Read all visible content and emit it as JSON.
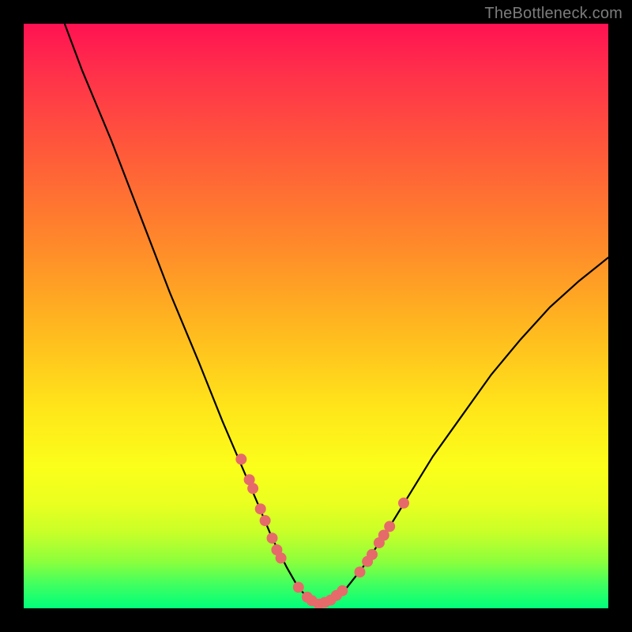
{
  "watermark": "TheBottleneck.com",
  "chart_data": {
    "type": "line",
    "title": "",
    "xlabel": "",
    "ylabel": "",
    "xlim": [
      0,
      100
    ],
    "ylim": [
      0,
      100
    ],
    "grid": false,
    "legend": false,
    "series": [
      {
        "name": "curve",
        "x": [
          7,
          10,
          15,
          20,
          25,
          30,
          34,
          37,
          40,
          42.5,
          45,
          47,
          49,
          50.5,
          52,
          55,
          58,
          62,
          66,
          70,
          75,
          80,
          85,
          90,
          95,
          100
        ],
        "y": [
          100,
          92,
          80,
          67,
          54,
          42,
          32,
          25,
          18,
          12,
          7,
          3.5,
          1.4,
          0.6,
          1.2,
          3.2,
          7,
          13,
          19.5,
          26,
          33,
          40,
          46,
          51.5,
          56,
          60
        ]
      }
    ],
    "markers_left": [
      {
        "x": 37.2,
        "y": 25.5
      },
      {
        "x": 38.6,
        "y": 22.0
      },
      {
        "x": 39.2,
        "y": 20.5
      },
      {
        "x": 40.5,
        "y": 17.0
      },
      {
        "x": 41.3,
        "y": 15.0
      },
      {
        "x": 42.5,
        "y": 12.0
      },
      {
        "x": 43.3,
        "y": 10.0
      },
      {
        "x": 44.0,
        "y": 8.6
      }
    ],
    "markers_bottom": [
      {
        "x": 47.0,
        "y": 3.6
      },
      {
        "x": 48.5,
        "y": 1.9
      },
      {
        "x": 49.3,
        "y": 1.3
      },
      {
        "x": 50.5,
        "y": 0.7
      },
      {
        "x": 51.5,
        "y": 1.0
      },
      {
        "x": 52.5,
        "y": 1.4
      },
      {
        "x": 53.5,
        "y": 2.2
      },
      {
        "x": 54.5,
        "y": 3.0
      }
    ],
    "markers_right": [
      {
        "x": 57.5,
        "y": 6.2
      },
      {
        "x": 58.8,
        "y": 8.0
      },
      {
        "x": 59.6,
        "y": 9.2
      },
      {
        "x": 60.8,
        "y": 11.2
      },
      {
        "x": 61.6,
        "y": 12.5
      },
      {
        "x": 62.6,
        "y": 14.0
      },
      {
        "x": 65.0,
        "y": 18.0
      }
    ],
    "marker_color": "#e66a6a",
    "marker_radius_px": 7
  }
}
